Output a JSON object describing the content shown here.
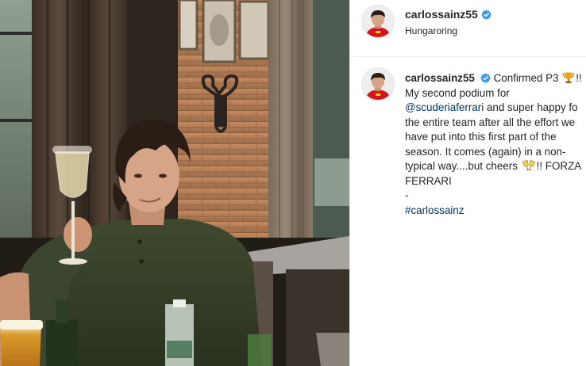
{
  "post": {
    "username": "carlossainz55",
    "location": "Hungaroring",
    "verified": true,
    "media_subject": "photo"
  },
  "caption": {
    "username": "carlossainz55",
    "line1_text": "Confirmed P3",
    "line1_suffix": "!!",
    "line2": "My second podium for",
    "mention": "@scuderiaferrari",
    "line3_rest": "and super happy fo",
    "line4": "the entire team after all the effort we",
    "line5": "have put into this first part of the",
    "line6": "season. It comes (again) in a non-",
    "line7_text": "typical way....but cheers",
    "line7_suffix": "!! FORZA",
    "line8": "FERRARI",
    "line9": "-",
    "hashtag": "#carlossainz",
    "emoji_1": "trophy-icon",
    "emoji_2": "clinking-glasses-icon"
  },
  "colors": {
    "link": "#00376b",
    "verified": "#3897f0",
    "text": "#262626",
    "border": "#efefef"
  }
}
